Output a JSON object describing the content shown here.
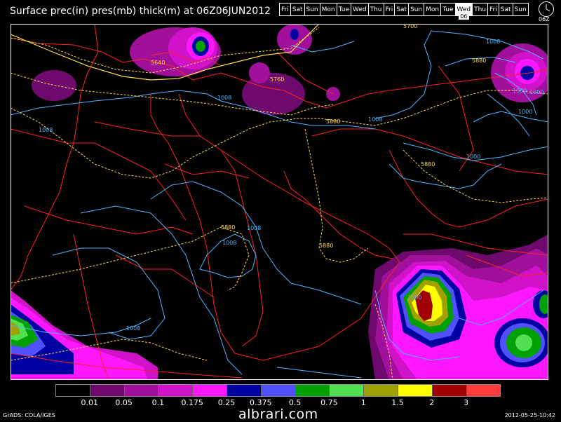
{
  "title": "Surface prec(in) pres(mb) thick(m) at 06Z06JUN2012",
  "days": [
    "Fri",
    "Sat",
    "Sun",
    "Mon",
    "Tue",
    "Wed",
    "Thu",
    "Fri",
    "Sat",
    "Sun",
    "Mon",
    "Tue",
    "Wed",
    "Thu",
    "Fri",
    "Sat",
    "Sun"
  ],
  "selected_day_sub": "06",
  "clock_label": "06Z",
  "legend": {
    "colors": [
      "#000000",
      "#6e0a6e",
      "#a0109a",
      "#d012c8",
      "#ff17ff",
      "#0000a0",
      "#5050ff",
      "#00a000",
      "#50e050",
      "#a0a000",
      "#ffff00",
      "#a00000",
      "#ff3c3c"
    ],
    "labels": [
      "0.01",
      "0.05",
      "0.1",
      "0.175",
      "0.25",
      "0.375",
      "0.5",
      "0.75",
      "1",
      "1.5",
      "2",
      "3"
    ]
  },
  "contour_labels": {
    "l5640": "5640",
    "l5700": "5700",
    "l5760": "5760",
    "l5880a": "5880",
    "l5880b": "5880",
    "l5880c": "5880",
    "l5880d": "5880",
    "l5880e": "5880",
    "l1008a": "1008",
    "l1008b": "1008",
    "l1008c": "1008",
    "l1008d": "1008",
    "l1008e": "1008",
    "l1008f": "1008",
    "l1008g": "1008",
    "l1000a": "1000",
    "l1000b": "1000",
    "l1000c": "1000",
    "l1000d": "1000",
    "l1000e": "1000"
  },
  "footer_left": "GrADS: COLA/IGES",
  "footer_right": "2012-05-25-10:42",
  "watermark": "albrari.com",
  "colors": {
    "background": "#000000",
    "border": "#ff0000",
    "isobar": "#4fb4ff",
    "thickness": "#ffd84a",
    "text": "#ffffff"
  }
}
